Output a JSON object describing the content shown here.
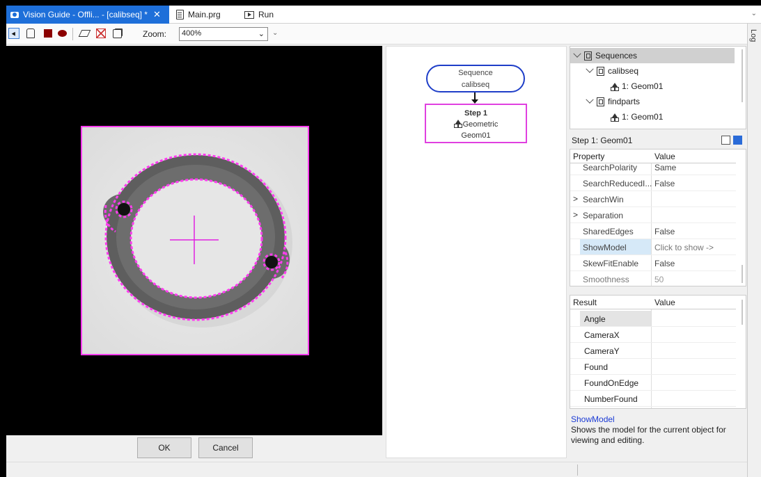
{
  "tabs": [
    {
      "label": "Vision Guide - Offli... - [calibseq] *",
      "close": "✕"
    },
    {
      "label": "Main.prg"
    },
    {
      "label": "Run"
    }
  ],
  "tab_overflow": "⌄",
  "toolbar": {
    "zoom_label": "Zoom:",
    "zoom_value": "400%",
    "zoom_chevron": "⌄",
    "overflow": "⌄"
  },
  "log_label": "Log",
  "buttons": {
    "ok": "OK",
    "cancel": "Cancel"
  },
  "flowchart": {
    "sequence_label": "Sequence",
    "sequence_name": "calibseq",
    "step_title": "Step 1",
    "step_type": "Geometric",
    "step_name": "Geom01"
  },
  "tree": {
    "root": "Sequences",
    "items": [
      {
        "label": "calibseq",
        "child": "1: Geom01"
      },
      {
        "label": "findparts",
        "child": "1: Geom01"
      }
    ]
  },
  "properties": {
    "header": "Step 1: Geom01",
    "col_property": "Property",
    "col_value": "Value",
    "rows": [
      {
        "name": "SearchPolarity",
        "value": "Same"
      },
      {
        "name": "SearchReducedI...",
        "value": "False"
      },
      {
        "name": "SearchWin",
        "value": "",
        "expandable": ">"
      },
      {
        "name": "Separation",
        "value": "",
        "expandable": ">"
      },
      {
        "name": "SharedEdges",
        "value": "False"
      },
      {
        "name": "ShowModel",
        "value": "Click to show ->"
      },
      {
        "name": "SkewFitEnable",
        "value": "False"
      },
      {
        "name": "Smoothness",
        "value": "50"
      }
    ]
  },
  "results": {
    "col_result": "Result",
    "col_value": "Value",
    "rows": [
      {
        "name": "Angle",
        "value": ""
      },
      {
        "name": "CameraX",
        "value": ""
      },
      {
        "name": "CameraY",
        "value": ""
      },
      {
        "name": "Found",
        "value": ""
      },
      {
        "name": "FoundOnEdge",
        "value": ""
      },
      {
        "name": "NumberFound",
        "value": ""
      }
    ]
  },
  "description": {
    "title": "ShowModel",
    "text": "Shows the model for the current object for viewing and editing."
  },
  "colors": {
    "accent": "#1e6fd9",
    "edge_highlight": "#ff3cf0",
    "sequence_border": "#1e3ec8"
  }
}
